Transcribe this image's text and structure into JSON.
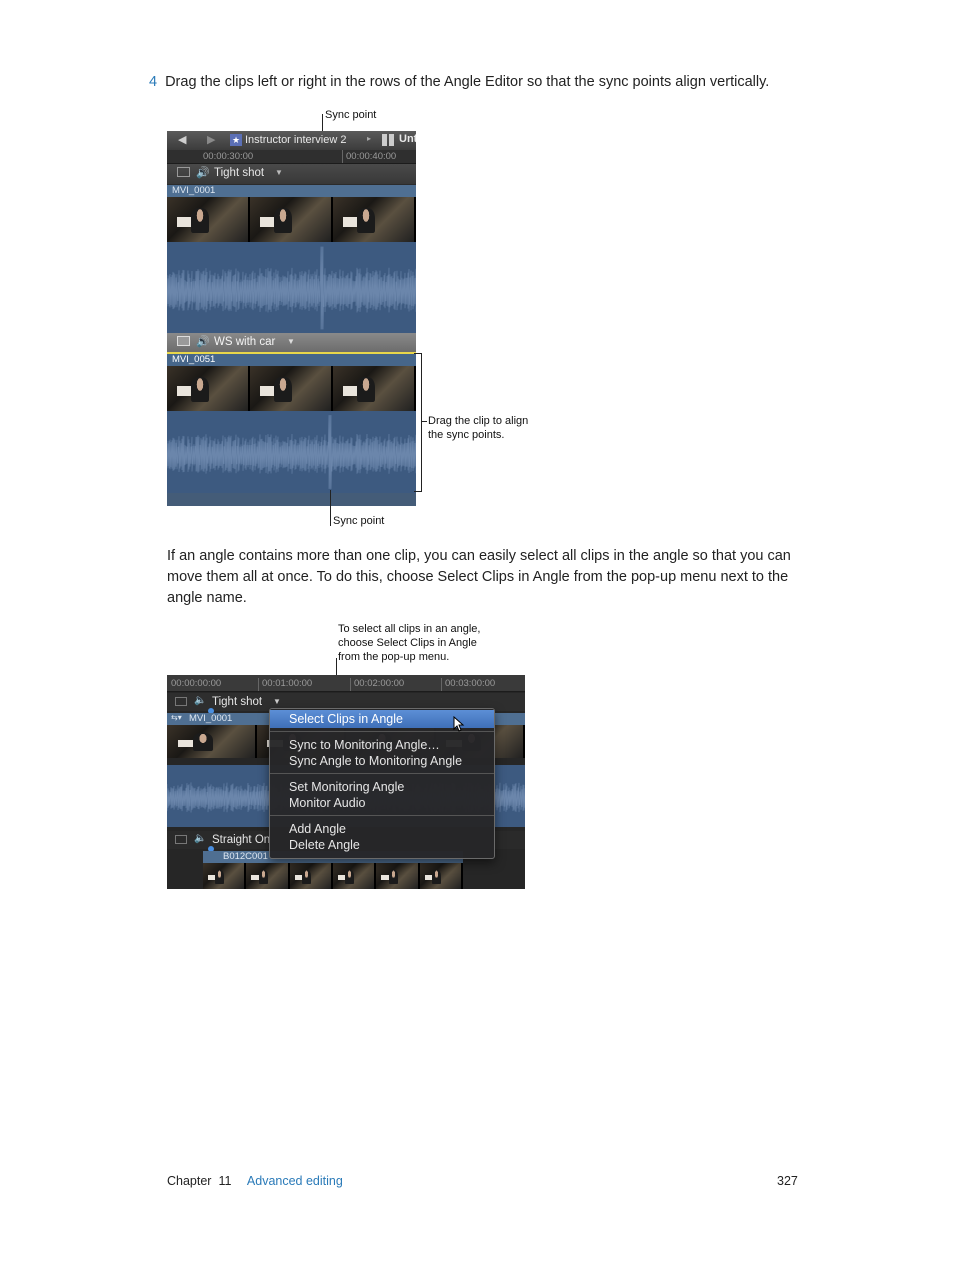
{
  "step": {
    "number": "4",
    "text": "Drag the clips left or right in the rows of the Angle Editor so that the sync points align vertically."
  },
  "figure1": {
    "callout_top": "Sync point",
    "callout_right_line1": "Drag the clip to align",
    "callout_right_line2": "the sync points.",
    "callout_bottom": "Sync point",
    "toolbar_title": "Instructor interview 2",
    "toolbar_right": "Unt",
    "ruler_left": "00:00:30:00",
    "ruler_right": "00:00:40:00",
    "angle1_name": "Tight shot",
    "clip1_name": "MVI_0001",
    "angle2_name": "WS with car",
    "clip2_name": "MVI_0051"
  },
  "paragraph": "If an angle contains more than one clip, you can easily select all clips in the angle so that you can move them all at once. To do this, choose Select Clips in Angle from the pop-up menu next to the angle name.",
  "figure2": {
    "callout_line1": "To select all clips in an angle,",
    "callout_line2": "choose Select Clips in Angle",
    "callout_line3": "from the pop-up menu.",
    "ruler": [
      "00:00:00:00",
      "00:01:00:00",
      "00:02:00:00",
      "00:03:00:00"
    ],
    "angle1_name": "Tight shot",
    "clip1_name": "MVI_0001",
    "angle2_name": "Straight On",
    "clip2_name": "B012C001",
    "menu": {
      "highlighted": "Select Clips in Angle",
      "group2": [
        "Sync to Monitoring Angle…",
        "Sync Angle to Monitoring Angle"
      ],
      "group3": [
        "Set Monitoring Angle",
        "Monitor Audio"
      ],
      "group4": [
        "Add Angle",
        "Delete Angle"
      ]
    }
  },
  "footer": {
    "chapter_label": "Chapter",
    "chapter_number": "11",
    "chapter_title": "Advanced editing",
    "page_number": "327"
  },
  "colors": {
    "accent": "#2a7ab8",
    "waveform": "#3d5a80",
    "clip_label": "#4f6f92",
    "menu_highlight": "#4a7cc6"
  }
}
